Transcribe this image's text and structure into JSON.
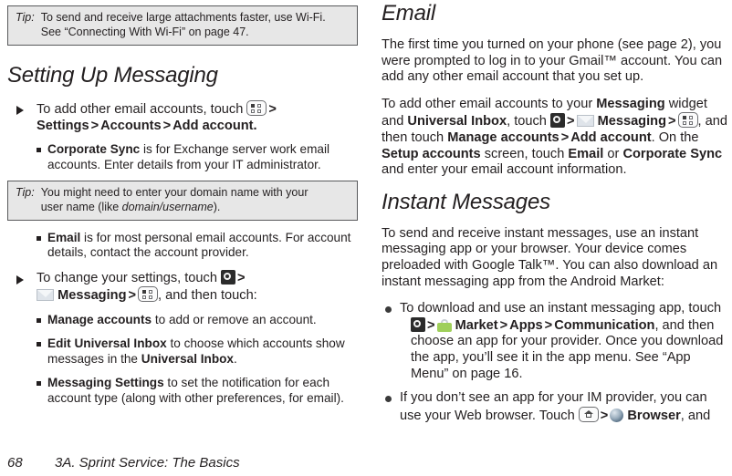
{
  "document": {
    "footer_page_number": "68",
    "footer_chapter": "3A. Sprint Service: The Basics"
  },
  "icons": {
    "app_menu": "app-menu-icon",
    "launcher": "launcher-icon",
    "messaging": "envelope-icon",
    "market": "market-bag-icon",
    "home": "home-icon",
    "browser": "globe-icon",
    "gt": ">"
  },
  "left_column": {
    "tip_wifi": {
      "label": "Tip:",
      "line1": "To send and receive large attachments faster, use Wi-Fi.",
      "line2": "See “Connecting With Wi-Fi” on page 47."
    },
    "heading": "Setting Up Messaging",
    "item_add_accounts": {
      "text_1": "To add other email accounts, touch ",
      "text_2": " Settings ",
      "text_3": " Accounts ",
      "text_4": " Add account.",
      "bold_settings": "Settings",
      "bold_accounts": "Accounts",
      "bold_add_account": "Add account."
    },
    "sub_corporate_sync": {
      "bold": "Corporate Sync",
      "text": " is for Exchange server work email accounts. Enter details from your IT administrator."
    },
    "tip_domain": {
      "label": "Tip:",
      "line1": "You might need to enter your domain name with your",
      "line2_pre": "user name (like ",
      "line2_italic": "domain/username",
      "line2_post": ")."
    },
    "sub_email": {
      "bold": "Email",
      "text": " is for most personal email accounts. For account details, contact the account provider."
    },
    "item_change_settings": {
      "text_1": "To change your settings, touch ",
      "bold_messaging": "Messaging",
      "text_2": ", and then touch:"
    },
    "sub_manage_accounts": {
      "bold": "Manage accounts",
      "text": " to add or remove an account."
    },
    "sub_edit_universal_inbox": {
      "bold_1": "Edit Universal Inbox",
      "text": " to choose which accounts show messages in the ",
      "bold_2": "Universal Inbox",
      "text_end": "."
    },
    "sub_messaging_settings": {
      "bold": "Messaging Settings",
      "text": " to set the notification for each account type (along with other preferences, for email)."
    }
  },
  "right_column": {
    "heading_email": "Email",
    "para_first_time": "The first time you turned on your phone (see page 2), you were prompted to log in to your Gmail™ account. You can add any other email account that you set up.",
    "para_add_accounts": {
      "t1": "To add other email accounts to your ",
      "b1": "Messaging",
      "t2": " widget and ",
      "b2": "Universal Inbox",
      "t3": ", touch ",
      "b3": "Messaging",
      "t4": ", and then touch ",
      "b4": "Manage accounts",
      "b5": "Add account",
      "t5": ". On the ",
      "b6": "Setup accounts",
      "t6": " screen, touch ",
      "b7": "Email",
      "t7": " or ",
      "b8": "Corporate Sync",
      "t8": " and enter your email account information."
    },
    "heading_instant_messages": "Instant Messages",
    "para_instant": "To send and receive instant messages, use an instant messaging app or your browser. Your device comes preloaded with Google Talk™. You can also download an instant messaging app from the Android Market:",
    "bullet_download": {
      "t1": "To download and use an instant messaging app, touch ",
      "b1": "Market",
      "b2": "Apps",
      "b3": "Communication",
      "t2": ", and then choose an app for your provider. Once you download the app, you’ll see it in the app menu. See “App Menu” on page 16."
    },
    "bullet_browser": {
      "t1": "If you don’t see an app for your IM provider, you can use your Web browser. Touch ",
      "b1": "Browser",
      "t2": ", and"
    }
  }
}
